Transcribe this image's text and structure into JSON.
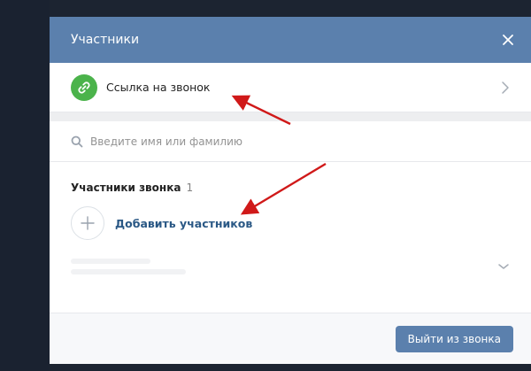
{
  "modal": {
    "title": "Участники",
    "close_icon": "close-icon"
  },
  "call_link": {
    "label": "Ссылка на звонок",
    "icon": "link-icon",
    "icon_color": "#4bb34b",
    "chevron_icon": "chevron-right-icon"
  },
  "search": {
    "placeholder": "Введите имя или фамилию",
    "value": "",
    "icon": "search-icon"
  },
  "members": {
    "title": "Участники звонка",
    "count": "1",
    "add_label": "Добавить участников",
    "add_icon": "plus-icon"
  },
  "footer": {
    "leave_label": "Выйти из звонка"
  },
  "colors": {
    "header": "#5b80ad",
    "link_text": "#2a5885",
    "annotation_arrow": "#d01919"
  }
}
